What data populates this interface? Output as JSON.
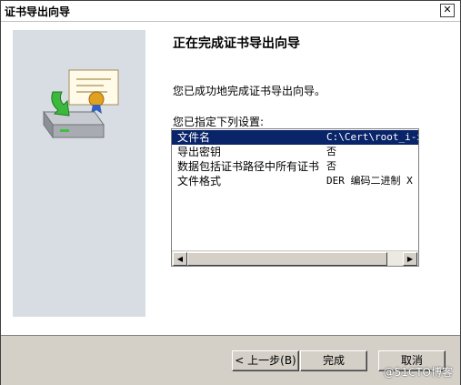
{
  "window": {
    "title": "证书导出向导",
    "close_glyph": "✕"
  },
  "page": {
    "heading": "正在完成证书导出向导",
    "success_text": "您已成功地完成证书导出向导。",
    "spec_label": "您已指定下列设置:"
  },
  "settings_list": {
    "rows": [
      {
        "key": "文件名",
        "value": "C:\\Cert\\root_i-x"
      },
      {
        "key": "导出密钥",
        "value": "否"
      },
      {
        "key": "数据包括证书路径中所有证书",
        "value": "否"
      },
      {
        "key": "文件格式",
        "value": "DER 编码二进制 X"
      }
    ]
  },
  "buttons": {
    "back": "< 上一步(B)",
    "finish": "完成",
    "cancel": "取消"
  },
  "watermark": "@51CTO博客",
  "colors": {
    "selection": "#0a246a",
    "panel": "#d8dde3",
    "chrome": "#d4d0c8"
  }
}
